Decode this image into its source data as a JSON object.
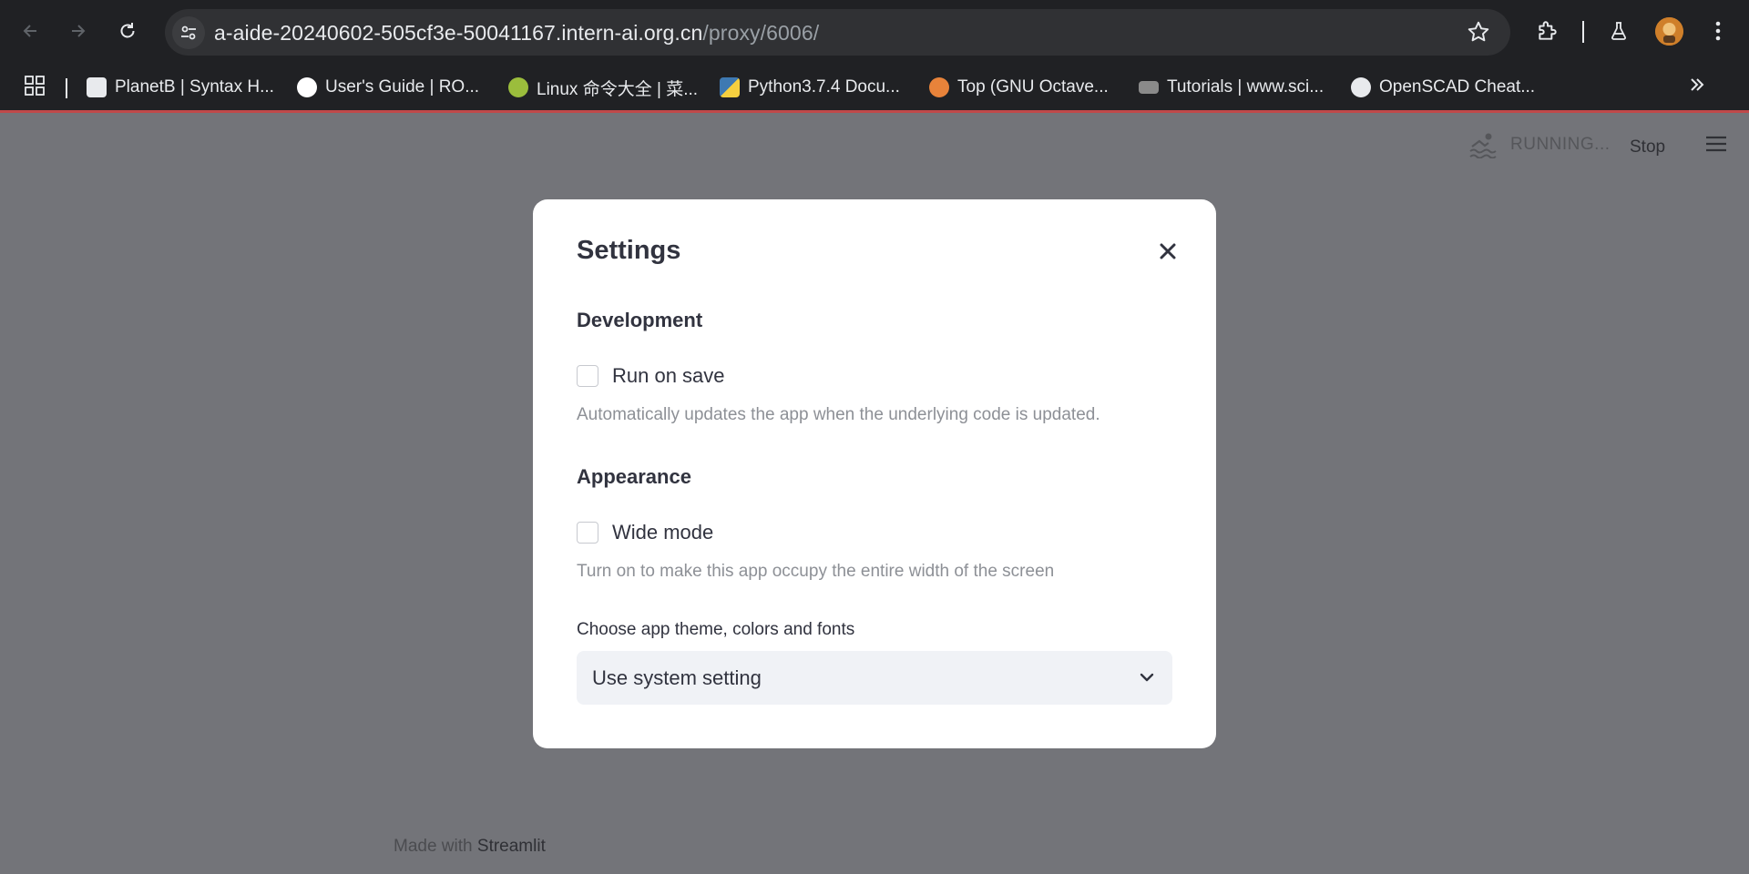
{
  "browser": {
    "url_host": "a-aide-20240602-505cf3e-50041167.intern-ai.org.cn",
    "url_path": "/proxy/6006/",
    "bookmarks": [
      {
        "label": "PlanetB | Syntax H...",
        "icon": "notion-icon",
        "color": "#e8eaed"
      },
      {
        "label": "User's Guide | RO...",
        "icon": "rocket-icon",
        "color": "#ffffff"
      },
      {
        "label": "Linux 命令大全 | 菜...",
        "icon": "runoob-icon",
        "color": "#9bbd3c"
      },
      {
        "label": "Python3.7.4 Docu...",
        "icon": "python-icon",
        "color": "#3e79b2"
      },
      {
        "label": "Top (GNU Octave...",
        "icon": "octave-icon",
        "color": "#e8833a"
      },
      {
        "label": "Tutorials | www.sci...",
        "icon": "scipy-icon",
        "color": "#8a8a8a"
      },
      {
        "label": "OpenSCAD Cheat...",
        "icon": "globe-icon",
        "color": "#e8eaed"
      }
    ]
  },
  "app": {
    "status_text": "RUNNING...",
    "stop_label": "Stop",
    "footer_prefix": "Made with",
    "footer_brand": "Streamlit"
  },
  "modal": {
    "title": "Settings",
    "development_heading": "Development",
    "run_on_save_label": "Run on save",
    "run_on_save_help": "Automatically updates the app when the underlying code is updated.",
    "appearance_heading": "Appearance",
    "wide_mode_label": "Wide mode",
    "wide_mode_help": "Turn on to make this app occupy the entire width of the screen",
    "theme_label": "Choose app theme, colors and fonts",
    "theme_value": "Use system setting"
  },
  "colors": {
    "page_overlay": "#737479",
    "modal_bg": "#ffffff",
    "text_primary": "#31333f",
    "text_help": "#8d9096",
    "loading_bar": "#c0494a"
  }
}
